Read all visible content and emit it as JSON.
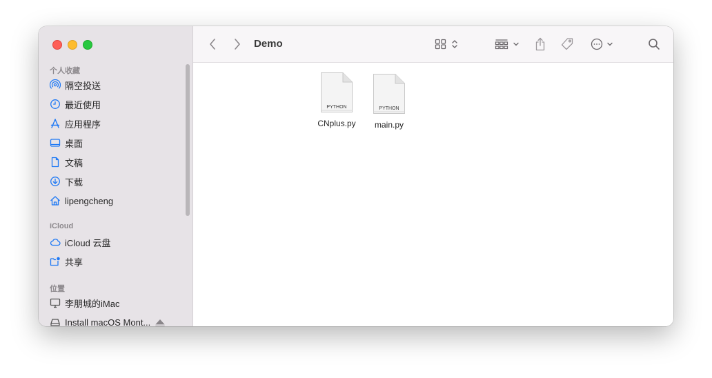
{
  "window": {
    "title": "Demo"
  },
  "sidebar": {
    "sections": [
      {
        "title": "个人收藏",
        "items": [
          {
            "label": "隔空投送",
            "icon": "airdrop-icon"
          },
          {
            "label": "最近使用",
            "icon": "clock-icon"
          },
          {
            "label": "应用程序",
            "icon": "applications-icon"
          },
          {
            "label": "桌面",
            "icon": "desktop-icon"
          },
          {
            "label": "文稿",
            "icon": "document-icon"
          },
          {
            "label": "下载",
            "icon": "download-icon"
          },
          {
            "label": "lipengcheng",
            "icon": "home-icon"
          }
        ]
      },
      {
        "title": "iCloud",
        "items": [
          {
            "label": "iCloud 云盘",
            "icon": "cloud-icon"
          },
          {
            "label": "共享",
            "icon": "shared-folder-icon"
          }
        ]
      },
      {
        "title": "位置",
        "items": [
          {
            "label": "李朋城的iMac",
            "icon": "imac-icon"
          },
          {
            "label": "Install macOS Mont...",
            "icon": "disk-icon"
          }
        ]
      }
    ]
  },
  "files": [
    {
      "name": "CNplus.py",
      "badge": "PYTHON"
    },
    {
      "name": "main.py",
      "badge": "PYTHON"
    }
  ],
  "colors": {
    "accent": "#1d78f5",
    "sidebar_bg": "#e7e3e7",
    "toolbar_bg": "#f8f6f8"
  }
}
